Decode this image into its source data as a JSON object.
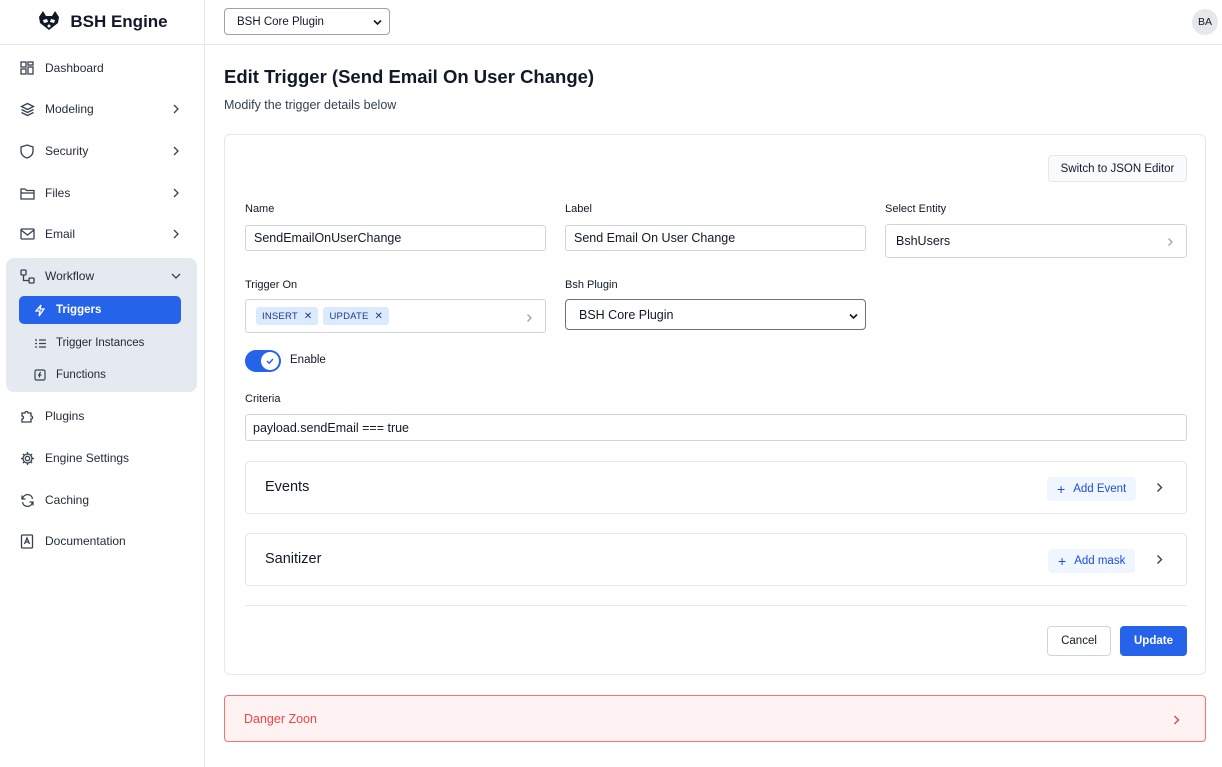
{
  "brand": {
    "name": "BSH Engine"
  },
  "topbar": {
    "plugin_selected": "BSH Core Plugin",
    "avatar_initials": "BA"
  },
  "sidebar": {
    "items": [
      {
        "label": "Dashboard",
        "icon": "dashboard-icon"
      },
      {
        "label": "Modeling",
        "icon": "layers-icon"
      },
      {
        "label": "Security",
        "icon": "shield-icon"
      },
      {
        "label": "Files",
        "icon": "folder-icon"
      },
      {
        "label": "Email",
        "icon": "mail-icon"
      },
      {
        "label": "Workflow",
        "icon": "workflow-icon"
      },
      {
        "label": "Plugins",
        "icon": "puzzle-icon"
      },
      {
        "label": "Engine Settings",
        "icon": "gear-icon"
      },
      {
        "label": "Caching",
        "icon": "refresh-icon"
      },
      {
        "label": "Documentation",
        "icon": "book-icon"
      }
    ],
    "workflow_children": [
      {
        "label": "Triggers",
        "icon": "lightning-icon",
        "active": true
      },
      {
        "label": "Trigger Instances",
        "icon": "list-icon"
      },
      {
        "label": "Functions",
        "icon": "function-icon"
      }
    ]
  },
  "page": {
    "title": "Edit Trigger (Send Email On User Change)",
    "subtitle": "Modify the trigger details below"
  },
  "form": {
    "json_editor_label": "Switch to JSON Editor",
    "name_label": "Name",
    "name_value": "SendEmailOnUserChange",
    "label_label": "Label",
    "label_value": "Send Email On User Change",
    "entity_label": "Select Entity",
    "entity_value": "BshUsers",
    "trigger_on_label": "Trigger On",
    "trigger_on_values": [
      "INSERT",
      "UPDATE"
    ],
    "plugin_label": "Bsh Plugin",
    "plugin_value": "BSH Core Plugin",
    "enable_label": "Enable",
    "enabled": true,
    "criteria_label": "Criteria",
    "criteria_value": "payload.sendEmail === true",
    "events_title": "Events",
    "add_event_label": "Add Event",
    "sanitizer_title": "Sanitizer",
    "add_mask_label": "Add mask",
    "cancel_label": "Cancel",
    "update_label": "Update"
  },
  "danger": {
    "label": "Danger Zoon"
  },
  "colors": {
    "primary": "#2563eb",
    "danger": "#ef4444",
    "active_group_bg": "#e5e9f0"
  }
}
